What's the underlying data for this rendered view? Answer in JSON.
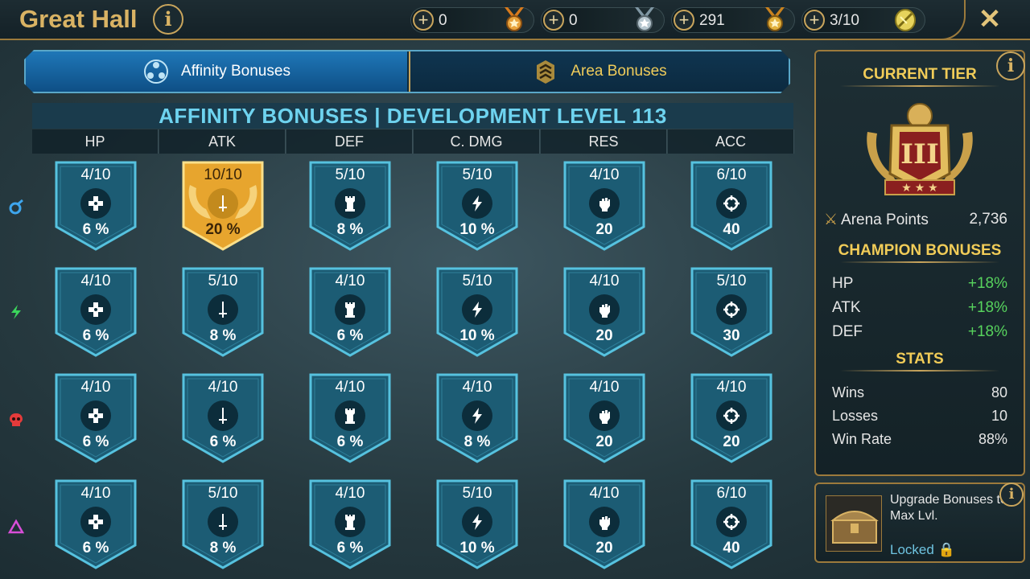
{
  "header": {
    "title": "Great Hall",
    "resources": [
      {
        "value": "0",
        "icon": "gold-medal-icon"
      },
      {
        "value": "0",
        "icon": "silver-medal-icon"
      },
      {
        "value": "291",
        "icon": "bronze-medal-icon"
      },
      {
        "value": "3/10",
        "icon": "arena-token-icon"
      }
    ]
  },
  "tabs": {
    "affinity": "Affinity Bonuses",
    "area": "Area Bonuses"
  },
  "table": {
    "title": "AFFINITY BONUSES | DEVELOPMENT LEVEL 113",
    "columns": [
      "HP",
      "ATK",
      "DEF",
      "C. DMG",
      "RES",
      "ACC"
    ],
    "rows": [
      {
        "affinity": "magic",
        "cells": [
          {
            "level": "4/10",
            "value": "6 %"
          },
          {
            "level": "10/10",
            "value": "20 %",
            "maxed": true
          },
          {
            "level": "5/10",
            "value": "8 %"
          },
          {
            "level": "5/10",
            "value": "10 %"
          },
          {
            "level": "4/10",
            "value": "20"
          },
          {
            "level": "6/10",
            "value": "40"
          }
        ]
      },
      {
        "affinity": "spirit",
        "cells": [
          {
            "level": "4/10",
            "value": "6 %"
          },
          {
            "level": "5/10",
            "value": "8 %"
          },
          {
            "level": "4/10",
            "value": "6 %"
          },
          {
            "level": "5/10",
            "value": "10 %"
          },
          {
            "level": "4/10",
            "value": "20"
          },
          {
            "level": "5/10",
            "value": "30"
          }
        ]
      },
      {
        "affinity": "force",
        "cells": [
          {
            "level": "4/10",
            "value": "6 %"
          },
          {
            "level": "4/10",
            "value": "6 %"
          },
          {
            "level": "4/10",
            "value": "6 %"
          },
          {
            "level": "4/10",
            "value": "8 %"
          },
          {
            "level": "4/10",
            "value": "20"
          },
          {
            "level": "4/10",
            "value": "20"
          }
        ]
      },
      {
        "affinity": "void",
        "cells": [
          {
            "level": "4/10",
            "value": "6 %"
          },
          {
            "level": "5/10",
            "value": "8 %"
          },
          {
            "level": "4/10",
            "value": "6 %"
          },
          {
            "level": "5/10",
            "value": "10 %"
          },
          {
            "level": "4/10",
            "value": "20"
          },
          {
            "level": "6/10",
            "value": "40"
          }
        ]
      }
    ]
  },
  "panel": {
    "current_tier_title": "CURRENT TIER",
    "tier_numeral": "III",
    "arena_points_label": "Arena Points",
    "arena_points_value": "2,736",
    "champion_bonuses_title": "CHAMPION BONUSES",
    "champion_bonuses": [
      {
        "label": "HP",
        "value": "+18%"
      },
      {
        "label": "ATK",
        "value": "+18%"
      },
      {
        "label": "DEF",
        "value": "+18%"
      }
    ],
    "stats_title": "STATS",
    "stats": [
      {
        "label": "Wins",
        "value": "80"
      },
      {
        "label": "Losses",
        "value": "10"
      },
      {
        "label": "Win Rate",
        "value": "88%"
      }
    ]
  },
  "upgrade": {
    "text": "Upgrade Bonuses to Max Lvl.",
    "status": "Locked 🔒"
  },
  "colors": {
    "gold_accent": "#d9b364",
    "badge_teal": "#1c5c74",
    "badge_border": "#56c2df",
    "badge_gold": "#e7a52e",
    "bonus_green": "#57d35d",
    "title_cyan": "#6ed3ef"
  }
}
